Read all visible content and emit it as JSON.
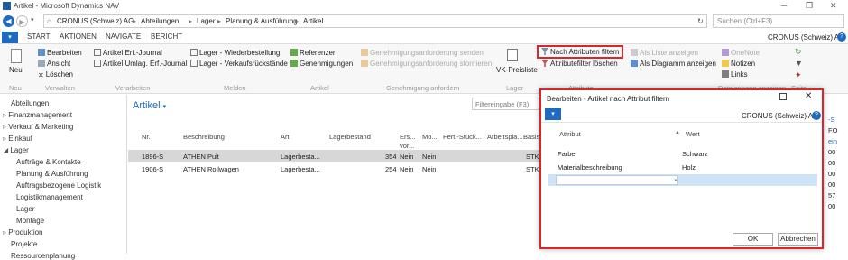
{
  "window": {
    "title": "Artikel - Microsoft Dynamics NAV"
  },
  "address": {
    "crumbs": [
      "CRONUS (Schweiz) AG",
      "Abteilungen",
      "Lager",
      "Planung & Ausführung",
      "Artikel"
    ],
    "search_placeholder": "Suchen (Ctrl+F3)"
  },
  "tabs": [
    "START",
    "AKTIONEN",
    "NAVIGATE",
    "BERICHT"
  ],
  "company": "CRONUS (Schweiz) AG",
  "ribbon": {
    "neu": {
      "label": "Neu",
      "group": "Neu"
    },
    "verwalten": {
      "items": [
        "Bearbeiten",
        "Ansicht",
        "Löschen"
      ],
      "group": "Verwalten"
    },
    "verarbeiten": {
      "items": [
        "Artikel Erf.-Journal",
        "Artikel Umlag. Erf.-Journal"
      ],
      "group": "Verarbeiten"
    },
    "melden": {
      "items": [
        "Lager - Wiederbestellung",
        "Lager - Verkaufsrückstände"
      ],
      "group": "Melden"
    },
    "artikel": {
      "items": [
        "Referenzen",
        "Genehmigungen"
      ],
      "group": "Artikel"
    },
    "genehmigung": {
      "items": [
        "Genehmigungsanforderung senden",
        "Genehmigungsanforderung stornieren"
      ],
      "group": "Genehmigung anfordern"
    },
    "lager": {
      "label": "VK-Preisliste",
      "group": "Lager"
    },
    "attribute": {
      "items": [
        "Nach Attributen filtern",
        "Attributefilter löschen"
      ],
      "group": "Attribute"
    },
    "anzeigen": {
      "items": [
        "Als Liste anzeigen",
        "Als Diagramm anzeigen"
      ]
    },
    "onenote": {
      "items": [
        "OneNote",
        "Notizen",
        "Links"
      ],
      "group": "Dateianhang anzeigen"
    },
    "seite": {
      "group": "Seite"
    }
  },
  "sidebar": {
    "items": [
      "Abteilungen",
      "Finanzmanagement",
      "Verkauf & Marketing",
      "Einkauf",
      "Lager",
      "Aufträge & Kontakte",
      "Planung & Ausführung",
      "Auftragsbezogene Logistik",
      "Logistikmanagement",
      "Lager",
      "Montage",
      "Produktion",
      "Projekte",
      "Ressourcenplanung"
    ]
  },
  "list": {
    "title": "Artikel",
    "filter_placeholder": "Filtereingabe (F3)",
    "columns": [
      "Nr.",
      "Beschreibung",
      "Art",
      "Lagerbestand",
      "Ers... vor...",
      "Mo...",
      "Fert.-Stück...",
      "Arbeitspla...",
      "Basiseinhe..."
    ],
    "rows": [
      [
        "1896-S",
        "ATHEN Pult",
        "Lagerbesta...",
        "354",
        "Nein",
        "Nein",
        "",
        "",
        "STK"
      ],
      [
        "1906-S",
        "ATHEN Rollwagen",
        "Lagerbesta...",
        "254",
        "Nein",
        "Nein",
        "",
        "",
        "STK"
      ]
    ],
    "right_edge": [
      "-S",
      "FO",
      "ein",
      "00",
      "00",
      "00",
      "00",
      "57",
      "00"
    ]
  },
  "dialog": {
    "title": "Bearbeiten - Artikel nach Attribut filtern",
    "company": "CRONUS (Schweiz) AG",
    "columns": [
      "Attribut",
      "Wert"
    ],
    "rows": [
      {
        "attribut": "Farbe",
        "wert": "Schwarz"
      },
      {
        "attribut": "Materialbeschreibung",
        "wert": "Holz"
      }
    ],
    "ok": "OK",
    "cancel": "Abbrechen"
  },
  "colors": {
    "accent": "#0a6ebd",
    "highlight": "#d9262b",
    "selected_row": "#d7d7d7"
  }
}
